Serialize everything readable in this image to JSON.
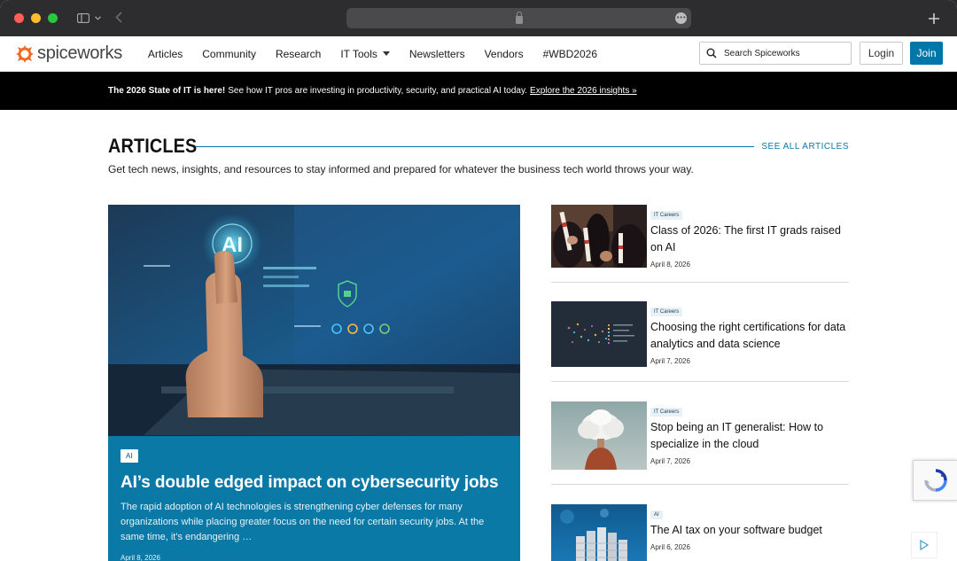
{
  "browser": {
    "url_display": ""
  },
  "nav": {
    "logo_text": "spiceworks",
    "items": [
      {
        "label": "Articles"
      },
      {
        "label": "Community"
      },
      {
        "label": "Research"
      },
      {
        "label": "IT Tools"
      },
      {
        "label": "Newsletters"
      },
      {
        "label": "Vendors"
      },
      {
        "label": "#WBD2026"
      }
    ],
    "search_placeholder": "Search Spiceworks",
    "login_label": "Login",
    "join_label": "Join"
  },
  "banner": {
    "bold_text": "The 2026 State of IT is here!",
    "text": "See how IT pros are investing in productivity, security, and practical AI today.",
    "link_text": "Explore the 2026 insights »"
  },
  "section": {
    "title": "ARTICLES",
    "see_all": "SEE ALL ARTICLES",
    "subtitle": "Get tech news, insights, and resources to stay informed and prepared for whatever the business tech world throws your way."
  },
  "feature": {
    "tag": "AI",
    "image_badge": "AI",
    "title": "AI’s double edged impact on cybersecurity jobs",
    "description": "The rapid adoption of AI technologies is strengthening cyber defenses for many organizations while placing greater focus on the need for certain security jobs. At the same time, it's endangering …",
    "date": "April 8, 2026"
  },
  "side_articles": [
    {
      "tag": "IT Careers",
      "title": "Class of 2026: The first IT grads raised on AI",
      "date": "April 8, 2026"
    },
    {
      "tag": "IT Careers",
      "title": "Choosing the right certifications for data analytics and data science",
      "date": "April 7, 2026"
    },
    {
      "tag": "IT Careers",
      "title": "Stop being an IT generalist: How to specialize in the cloud",
      "date": "April 7, 2026"
    },
    {
      "tag": "AI",
      "title": "The AI tax on your software budget",
      "date": "April 6, 2026"
    }
  ],
  "colors": {
    "brand_blue": "#0a79a6",
    "logo_orange": "#f26b21",
    "banner_bg": "#000000"
  },
  "icons": {
    "search": "search-icon",
    "caret": "chevron-down-icon",
    "lock": "lock-icon",
    "new_tab": "plus-icon",
    "recaptcha": "recaptcha-icon",
    "adchoices": "adchoices-icon"
  }
}
